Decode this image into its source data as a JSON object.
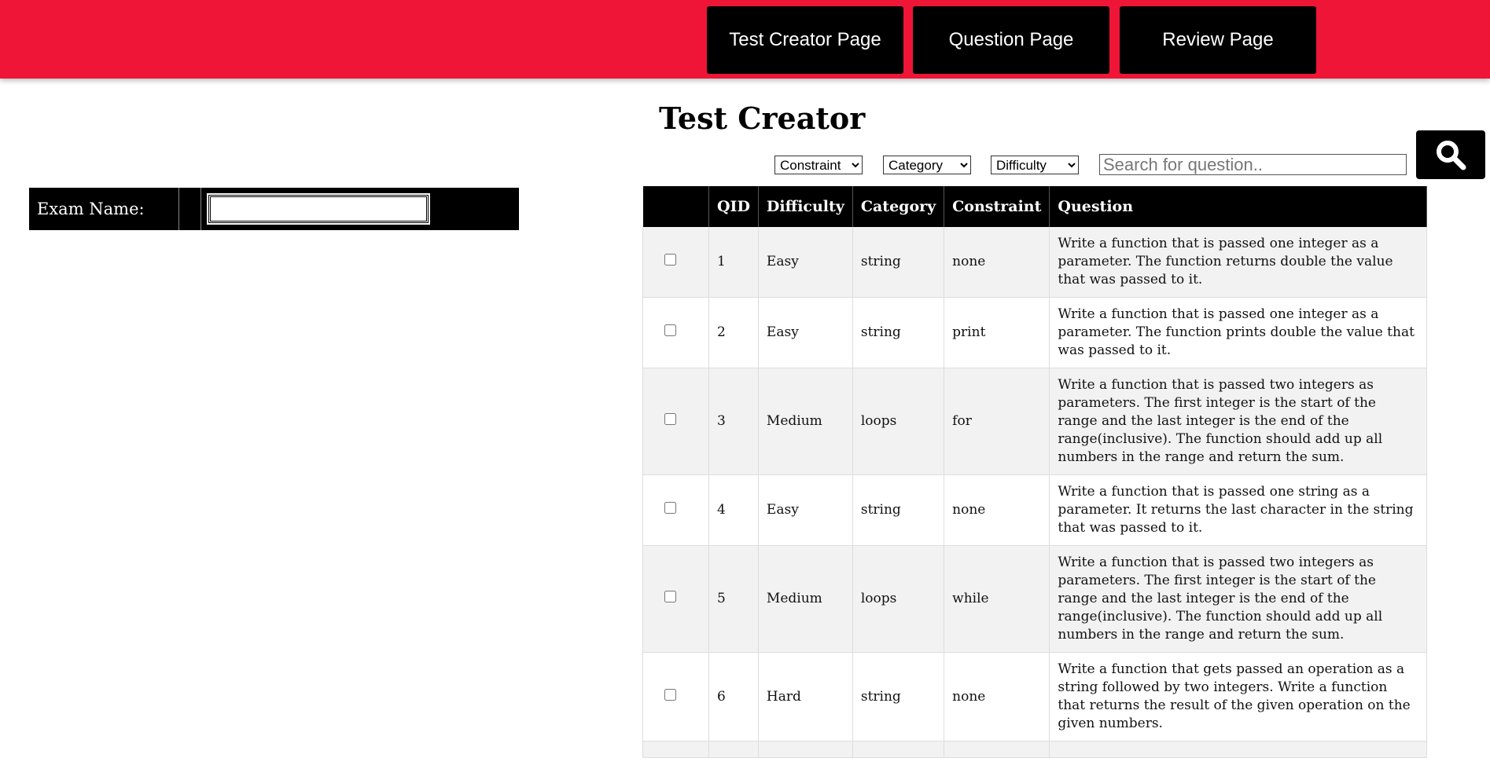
{
  "nav": {
    "buttons": [
      {
        "label": "Test Creator Page"
      },
      {
        "label": "Question Page"
      },
      {
        "label": "Review Page"
      }
    ]
  },
  "page_title": "Test Creator",
  "filters": {
    "constraint": {
      "selected": "Constraint"
    },
    "category": {
      "selected": "Category"
    },
    "difficulty": {
      "selected": "Difficulty"
    },
    "search_placeholder": "Search for question.."
  },
  "search_button": {
    "icon": "search-icon"
  },
  "exam": {
    "label": "Exam Name:",
    "value": ""
  },
  "table": {
    "headers": [
      "",
      "QID",
      "Difficulty",
      "Category",
      "Constraint",
      "Question"
    ],
    "rows": [
      {
        "qid": "1",
        "difficulty": "Easy",
        "category": "string",
        "constraint": "none",
        "question": "Write a function that is passed one integer as a parameter. The function returns double the value that was passed to it."
      },
      {
        "qid": "2",
        "difficulty": "Easy",
        "category": "string",
        "constraint": "print",
        "question": "Write a function that is passed one integer as a parameter. The function prints double the value that was passed to it."
      },
      {
        "qid": "3",
        "difficulty": "Medium",
        "category": "loops",
        "constraint": "for",
        "question": "Write a function that is passed two integers as parameters. The first integer is the start of the range and the last integer is the end of the range(inclusive). The function should add up all numbers in the range and return the sum."
      },
      {
        "qid": "4",
        "difficulty": "Easy",
        "category": "string",
        "constraint": "none",
        "question": "Write a function that is passed one string as a parameter. It returns the last character in the string that was passed to it."
      },
      {
        "qid": "5",
        "difficulty": "Medium",
        "category": "loops",
        "constraint": "while",
        "question": "Write a function that is passed two integers as parameters. The first integer is the start of the range and the last integer is the end of the range(inclusive). The function should add up all numbers in the range and return the sum."
      },
      {
        "qid": "6",
        "difficulty": "Hard",
        "category": "string",
        "constraint": "none",
        "question": "Write a function that gets passed an operation as a string followed by two integers. Write a function that returns the result of the given operation on the given numbers."
      }
    ]
  },
  "colors": {
    "topbar": "#ee1537",
    "header_bg": "#000000",
    "row_alt": "#f2f2f2"
  }
}
